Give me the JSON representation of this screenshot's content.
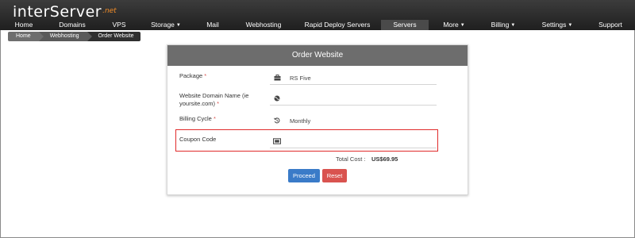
{
  "brand": {
    "name": "interServer",
    "suffix": ".net"
  },
  "nav": [
    {
      "label": "Home",
      "caret": false,
      "active": false
    },
    {
      "label": "Domains",
      "caret": false,
      "active": false
    },
    {
      "label": "VPS",
      "caret": false,
      "active": false
    },
    {
      "label": "Storage",
      "caret": true,
      "active": false
    },
    {
      "label": "Mail",
      "caret": false,
      "active": false
    },
    {
      "label": "Webhosting",
      "caret": false,
      "active": false
    },
    {
      "label": "Rapid Deploy Servers",
      "caret": false,
      "active": false
    },
    {
      "label": "Servers",
      "caret": false,
      "active": true
    },
    {
      "label": "More",
      "caret": true,
      "active": false
    },
    {
      "label": "Billing",
      "caret": true,
      "active": false
    },
    {
      "label": "Settings",
      "caret": true,
      "active": false
    },
    {
      "label": "Support",
      "caret": false,
      "active": false
    }
  ],
  "breadcrumb": [
    "Home",
    "Webhosting",
    "Order Website"
  ],
  "form": {
    "title": "Order Website",
    "package": {
      "label": "Package",
      "required": "*",
      "value": "RS Five",
      "icon": "briefcase-icon"
    },
    "domain": {
      "label_line1": "Website Domain Name (ie",
      "label_line2": "yoursite.com)",
      "required": "*",
      "value": "",
      "icon": "globe-icon"
    },
    "billing": {
      "label": "Billing Cycle",
      "required": "*",
      "value": "Monthly",
      "icon": "history-icon"
    },
    "coupon": {
      "label": "Coupon Code",
      "value": "",
      "icon": "ticket-icon"
    },
    "total_label": "Total Cost :",
    "total_value": "US$69.95",
    "proceed_label": "Proceed",
    "reset_label": "Reset"
  },
  "colors": {
    "topbar": "#262626",
    "proceed": "#3a7bc8",
    "reset": "#d9534f",
    "highlight": "#e02b2b",
    "required": "#d9534f"
  }
}
